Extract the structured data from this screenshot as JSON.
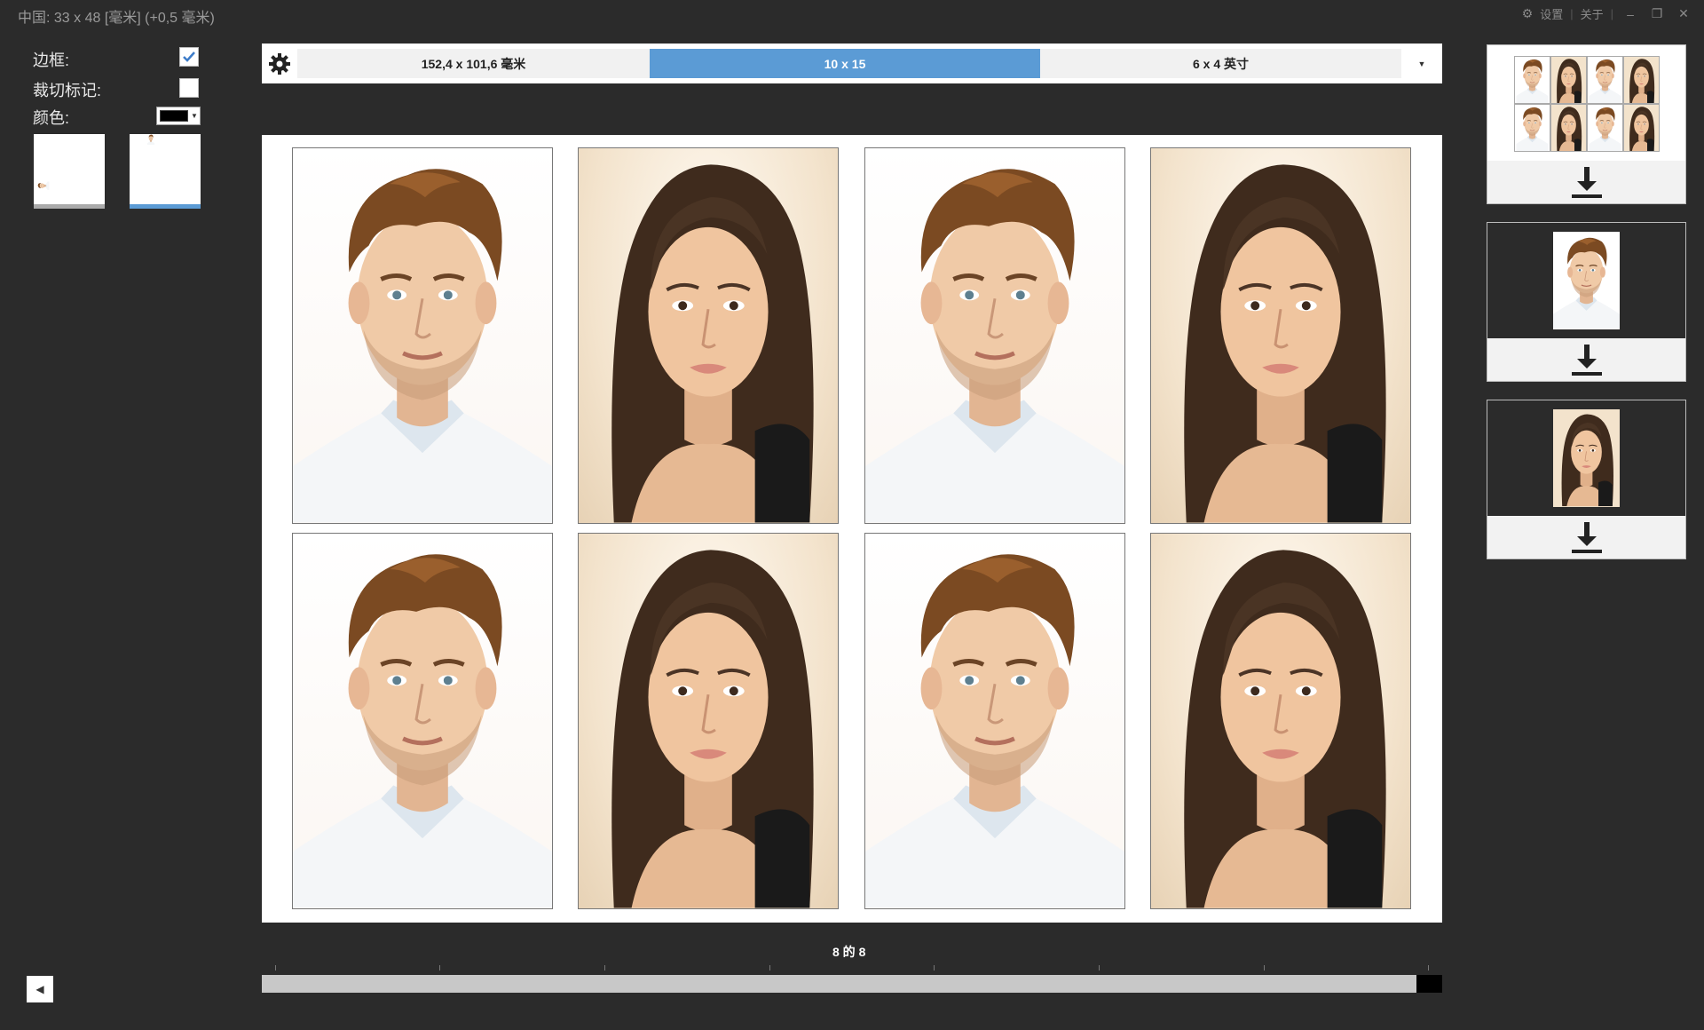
{
  "titlebar": {
    "title": "中国: 33 x 48 [毫米] (+0,5 毫米)",
    "settings_label": "设置",
    "about_label": "关于"
  },
  "options": {
    "border_label": "边框:",
    "border_checked": true,
    "crop_marks_label": "裁切标记:",
    "crop_marks_checked": false,
    "color_label": "颜色:",
    "color_value": "#000000",
    "orientation_selected": "portrait"
  },
  "format_bar": {
    "options": [
      "152,4 x 101,6 毫米",
      "10 x 15",
      "6 x 4 英寸"
    ],
    "selected_index": 1
  },
  "sheet": {
    "photos": [
      "male",
      "female",
      "male",
      "female",
      "male",
      "female",
      "male",
      "female"
    ]
  },
  "pagination": {
    "label": "8 的 8",
    "current": 8,
    "total": 8
  },
  "colors": {
    "accent": "#5b9bd5",
    "background": "#2b2b2b"
  },
  "exports": [
    {
      "type": "sheet-8-up"
    },
    {
      "type": "single-male"
    },
    {
      "type": "single-female"
    }
  ]
}
